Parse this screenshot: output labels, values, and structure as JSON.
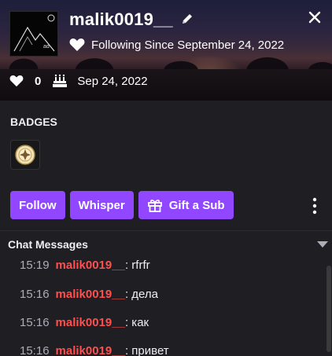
{
  "profile": {
    "username": "malik0019__",
    "following_text": "Following Since September 24, 2022"
  },
  "stats": {
    "followers_count": "0",
    "created_date": "Sep 24, 2022"
  },
  "badges": {
    "title": "BADGES"
  },
  "actions": {
    "follow": "Follow",
    "whisper": "Whisper",
    "gift_sub": "Gift a Sub"
  },
  "chat": {
    "title": "Chat Messages",
    "messages": [
      {
        "time": "15:19",
        "user": "malik0019__",
        "text": ": rfrfr"
      },
      {
        "time": "15:16",
        "user": "malik0019__",
        "text": ": дела"
      },
      {
        "time": "15:16",
        "user": "malik0019__",
        "text": ": как"
      },
      {
        "time": "15:16",
        "user": "malik0019__",
        "text": ": привет"
      }
    ]
  },
  "colors": {
    "accent": "#9147ff",
    "username_chat": "#ff4f4f",
    "background": "#1f1f23"
  },
  "icons": [
    "edit-icon",
    "close-icon",
    "heart-icon",
    "cake-icon",
    "badge-icon",
    "gift-icon",
    "more-options-icon",
    "chevron-down-icon"
  ]
}
